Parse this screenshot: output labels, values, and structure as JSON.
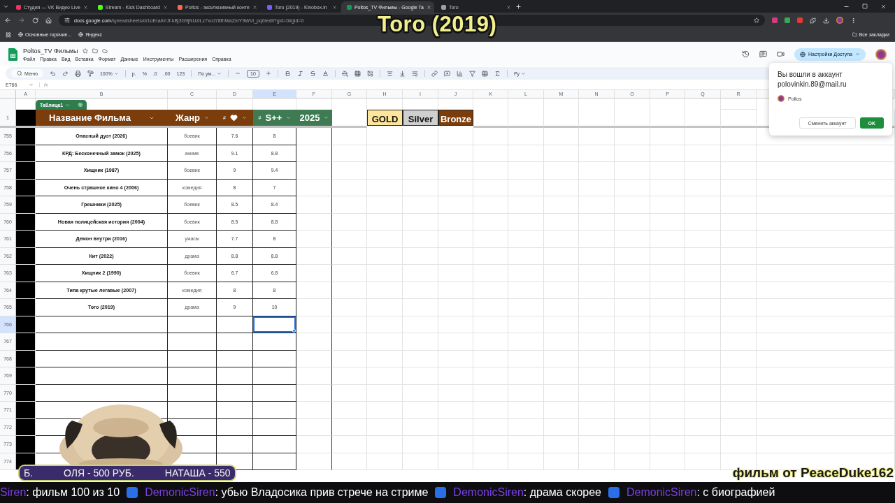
{
  "browser": {
    "tabs": [
      {
        "title": "Студия — VK Видео Live",
        "color": "#e8365d",
        "selected": false
      },
      {
        "title": "Stream - Kick Dashboard",
        "color": "#53fc18",
        "selected": false
      },
      {
        "title": "Poltos - эксклюзивный конте",
        "color": "#f96854",
        "selected": false
      },
      {
        "title": "Toro (2019) - Kinobox.in",
        "color": "#7b5cff",
        "selected": false
      },
      {
        "title": "Poltos_TV Фильмы - Google Ta",
        "color": "#0f9d58",
        "selected": true
      },
      {
        "title": "Toro",
        "color": "#9aa0a6",
        "selected": false
      }
    ],
    "url_host": "docs.google.com",
    "url_path": "/spreadsheets/d/1oEraAYJf-kBj3G9jNUzlLz7xcd78fhWaZmY9WVi_pq0/edit?gid=0#gid=0",
    "bookmarks": [
      "Основные горячие...",
      "Яндекс"
    ],
    "all_bookmarks": "Все закладки"
  },
  "stream_title": "Toro (2019)",
  "sheet": {
    "title": "Poltos_TV Фильмы",
    "menu": [
      "Файл",
      "Правка",
      "Вид",
      "Вставка",
      "Формат",
      "Данные",
      "Инструменты",
      "Расширения",
      "Справка"
    ],
    "access_button": "Настройки Доступа",
    "toolbar": {
      "search": "Меню",
      "zoom": "100%",
      "currency": "р.",
      "percent": "%",
      "decrease_decimals": ".0",
      "increase_decimals": ".00",
      "number_format": "123",
      "font": "По ум...",
      "font_size": "10",
      "input_tools": "Ру"
    },
    "name_box": "E766",
    "formula_label": "fx"
  },
  "columns": [
    {
      "letter": "A",
      "selected": false
    },
    {
      "letter": "B",
      "selected": false
    },
    {
      "letter": "C",
      "selected": false
    },
    {
      "letter": "D",
      "selected": false
    },
    {
      "letter": "E",
      "selected": true
    },
    {
      "letter": "F",
      "selected": false
    },
    {
      "letter": "G",
      "selected": false
    },
    {
      "letter": "H",
      "selected": false
    },
    {
      "letter": "I",
      "selected": false
    },
    {
      "letter": "J",
      "selected": false
    },
    {
      "letter": "K",
      "selected": false
    },
    {
      "letter": "L",
      "selected": false
    },
    {
      "letter": "M",
      "selected": false
    },
    {
      "letter": "N",
      "selected": false
    },
    {
      "letter": "O",
      "selected": false
    },
    {
      "letter": "P",
      "selected": false
    },
    {
      "letter": "Q",
      "selected": false
    },
    {
      "letter": "R",
      "selected": false
    }
  ],
  "table": {
    "name": "Таблица1",
    "header_row": "1",
    "headers": {
      "title": "Название Фильма",
      "genre": "Жанр",
      "score_hash": "#",
      "rating_hash": "#",
      "rating": "S++",
      "year": "2025"
    },
    "medals": [
      {
        "label": "GOLD",
        "kind": "gold"
      },
      {
        "label": "Silver",
        "kind": "silver"
      },
      {
        "label": "Bronze",
        "kind": "bronze"
      }
    ]
  },
  "rows": [
    {
      "number": "755",
      "title": "Опасный дуэт (2026)",
      "genre": "боевик",
      "score": "7.6",
      "rating": "8",
      "selected": false
    },
    {
      "number": "756",
      "title": "КРД: Бесконечный замок (2025)",
      "genre": "аниме",
      "score": "9.1",
      "rating": "8.8",
      "selected": false
    },
    {
      "number": "757",
      "title": "Хищник (1987)",
      "genre": "боевик",
      "score": "9",
      "rating": "9.4",
      "selected": false
    },
    {
      "number": "758",
      "title": "Очень страшное кино 4 (2006)",
      "genre": "комедия",
      "score": "8",
      "rating": "7",
      "selected": false
    },
    {
      "number": "759",
      "title": "Грешники (2025)",
      "genre": "боевик",
      "score": "8.5",
      "rating": "8.4",
      "selected": false
    },
    {
      "number": "760",
      "title": "Новая полицейская история (2004)",
      "genre": "боевик",
      "score": "8.5",
      "rating": "8.8",
      "selected": false
    },
    {
      "number": "761",
      "title": "Демон внутри (2016)",
      "genre": "ужасы",
      "score": "7.7",
      "rating": "8",
      "selected": false
    },
    {
      "number": "762",
      "title": "Кит (2022)",
      "genre": "драма",
      "score": "8.8",
      "rating": "8.8",
      "selected": false
    },
    {
      "number": "763",
      "title": "Хищник 2 (1990)",
      "genre": "боевик",
      "score": "6.7",
      "rating": "6.8",
      "selected": false
    },
    {
      "number": "764",
      "title": "Типа крутые легавые (2007)",
      "genre": "комедия",
      "score": "8",
      "rating": "8",
      "selected": false
    },
    {
      "number": "765",
      "title": "Того (2019)",
      "genre": "драма",
      "score": "9",
      "rating": "10",
      "selected": false
    },
    {
      "number": "766",
      "selected": true
    },
    {
      "number": "767",
      "selected": false
    },
    {
      "number": "768",
      "selected": false
    },
    {
      "number": "769",
      "selected": false
    },
    {
      "number": "770",
      "selected": false
    },
    {
      "number": "771",
      "selected": false
    },
    {
      "number": "772",
      "selected": false
    },
    {
      "number": "773",
      "selected": false
    },
    {
      "number": "774",
      "selected": false
    }
  ],
  "popup": {
    "heading": "Вы вошли в аккаунт",
    "email": "polovinkin.89@mail.ru",
    "account": "Poltos",
    "switch_button": "Сменить аккаунт",
    "ok_button": "OK"
  },
  "donations": [
    "Б.",
    "ОЛЯ - 500 РУБ.",
    "НАТАША - 550"
  ],
  "chat": [
    {
      "name": "Siren",
      "message": ": фильм 100 из 10"
    },
    {
      "name": "DemonicSiren",
      "message": ": убью Владосика прив стрече на стриме"
    },
    {
      "name": "DemonicSiren",
      "message": ": драма скорее"
    },
    {
      "name": "DemonicSiren",
      "message": ": с биографией"
    }
  ],
  "signature": "фильм от PeaceDuke162"
}
